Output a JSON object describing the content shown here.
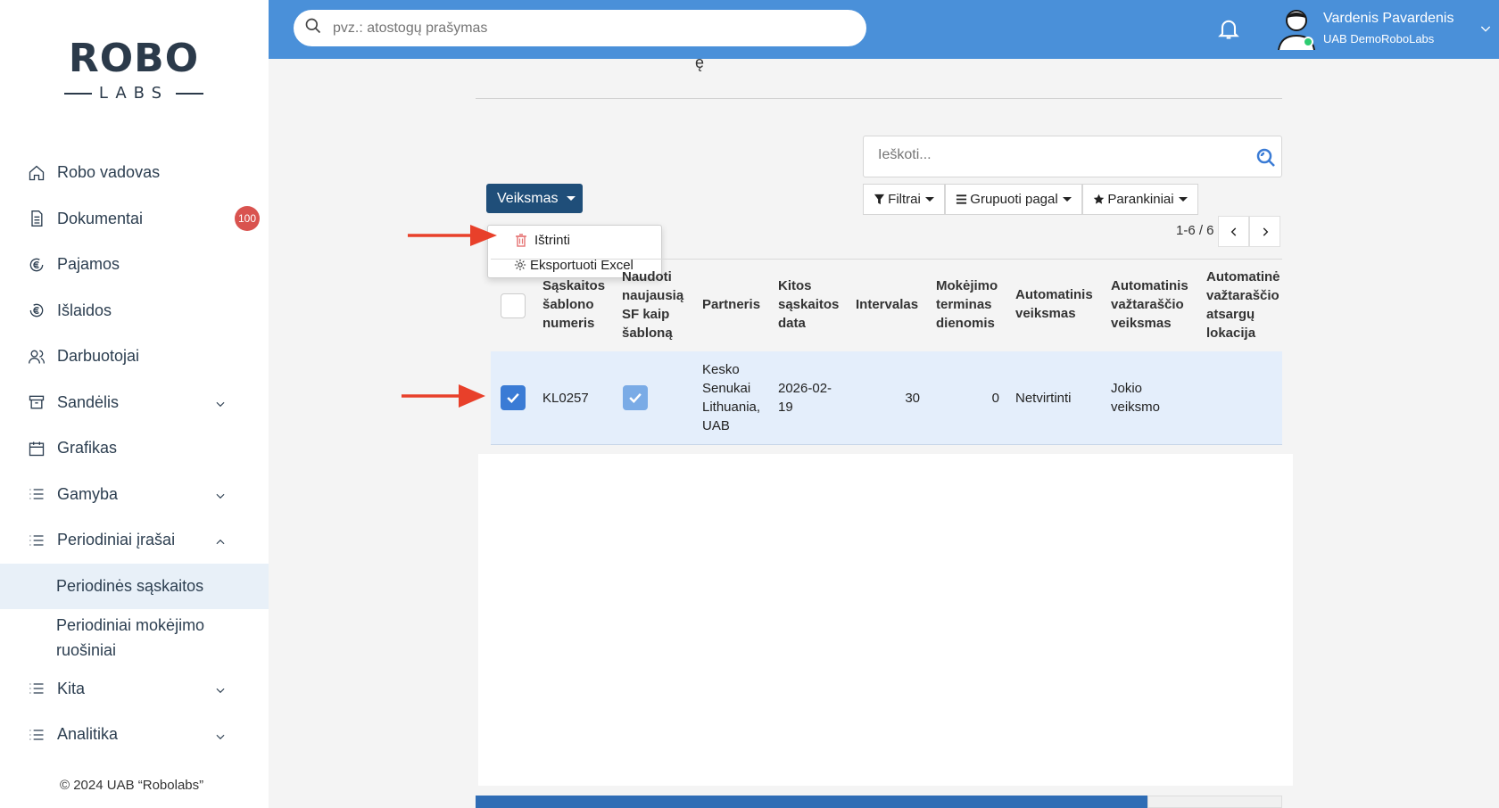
{
  "logo": {
    "main": "ROBO",
    "sub": "LABS"
  },
  "sidebar": {
    "items": [
      {
        "label": "Robo vadovas",
        "icon": "home-icon"
      },
      {
        "label": "Dokumentai",
        "icon": "document-icon",
        "badge": "100"
      },
      {
        "label": "Pajamos",
        "icon": "euro-in-icon"
      },
      {
        "label": "Išlaidos",
        "icon": "euro-out-icon"
      },
      {
        "label": "Darbuotojai",
        "icon": "users-icon"
      },
      {
        "label": "Sandėlis",
        "icon": "archive-icon"
      },
      {
        "label": "Grafikas",
        "icon": "calendar-icon"
      },
      {
        "label": "Gamyba",
        "icon": "list-icon"
      },
      {
        "label": "Periodiniai įrašai",
        "icon": "list-icon"
      }
    ],
    "sub_items": [
      {
        "label": "Periodinės sąskaitos",
        "active": true
      },
      {
        "label": "Periodiniai mokėjimo ruošiniai"
      }
    ],
    "items_after": [
      {
        "label": "Kita",
        "icon": "list-icon"
      },
      {
        "label": "Analitika",
        "icon": "list-icon"
      }
    ],
    "copyright": "© 2024 UAB “Robolabs”"
  },
  "topbar": {
    "search_placeholder": "pvz.: atostogų prašymas",
    "user_name": "Vardenis Pavardenis",
    "user_company": "UAB DemoRoboLabs"
  },
  "main": {
    "search_placeholder": "Ieškoti...",
    "action_button": "Veiksmas",
    "dropdown": [
      "Ištrinti",
      "Eksportuoti Excel"
    ],
    "filters": {
      "filters": "Filtrai",
      "group": "Grupuoti pagal",
      "favorites": "Parankiniai"
    },
    "pager": "1-6 / 6",
    "columns": [
      "Sąskaitos šablono numeris",
      "Naudoti naujausią SF kaip šabloną",
      "Partneris",
      "Kitos sąskaitos data",
      "Intervalas",
      "Mokėjimo terminas dienomis",
      "Automatinis veiksmas",
      "Automatinis važtaraščio veiksmas",
      "Automatinė važtaraščio atsargų lokacija"
    ],
    "row": {
      "selected": true,
      "number": "KL0257",
      "use_latest": true,
      "partner": "Kesko Senukai Lithuania, UAB",
      "next_date": "2026-02-19",
      "interval": "30",
      "payment_days": "0",
      "auto_action": "Netvirtinti",
      "auto_waybill_action": "Jokio veiksmo",
      "location": ""
    }
  },
  "colors": {
    "topbar": "#4a90d9",
    "action_button": "#1f4e79",
    "accent": "#3a7bd5",
    "badge": "#d9534f",
    "arrow": "#e8402a",
    "row_selected": "#e4eefb"
  }
}
